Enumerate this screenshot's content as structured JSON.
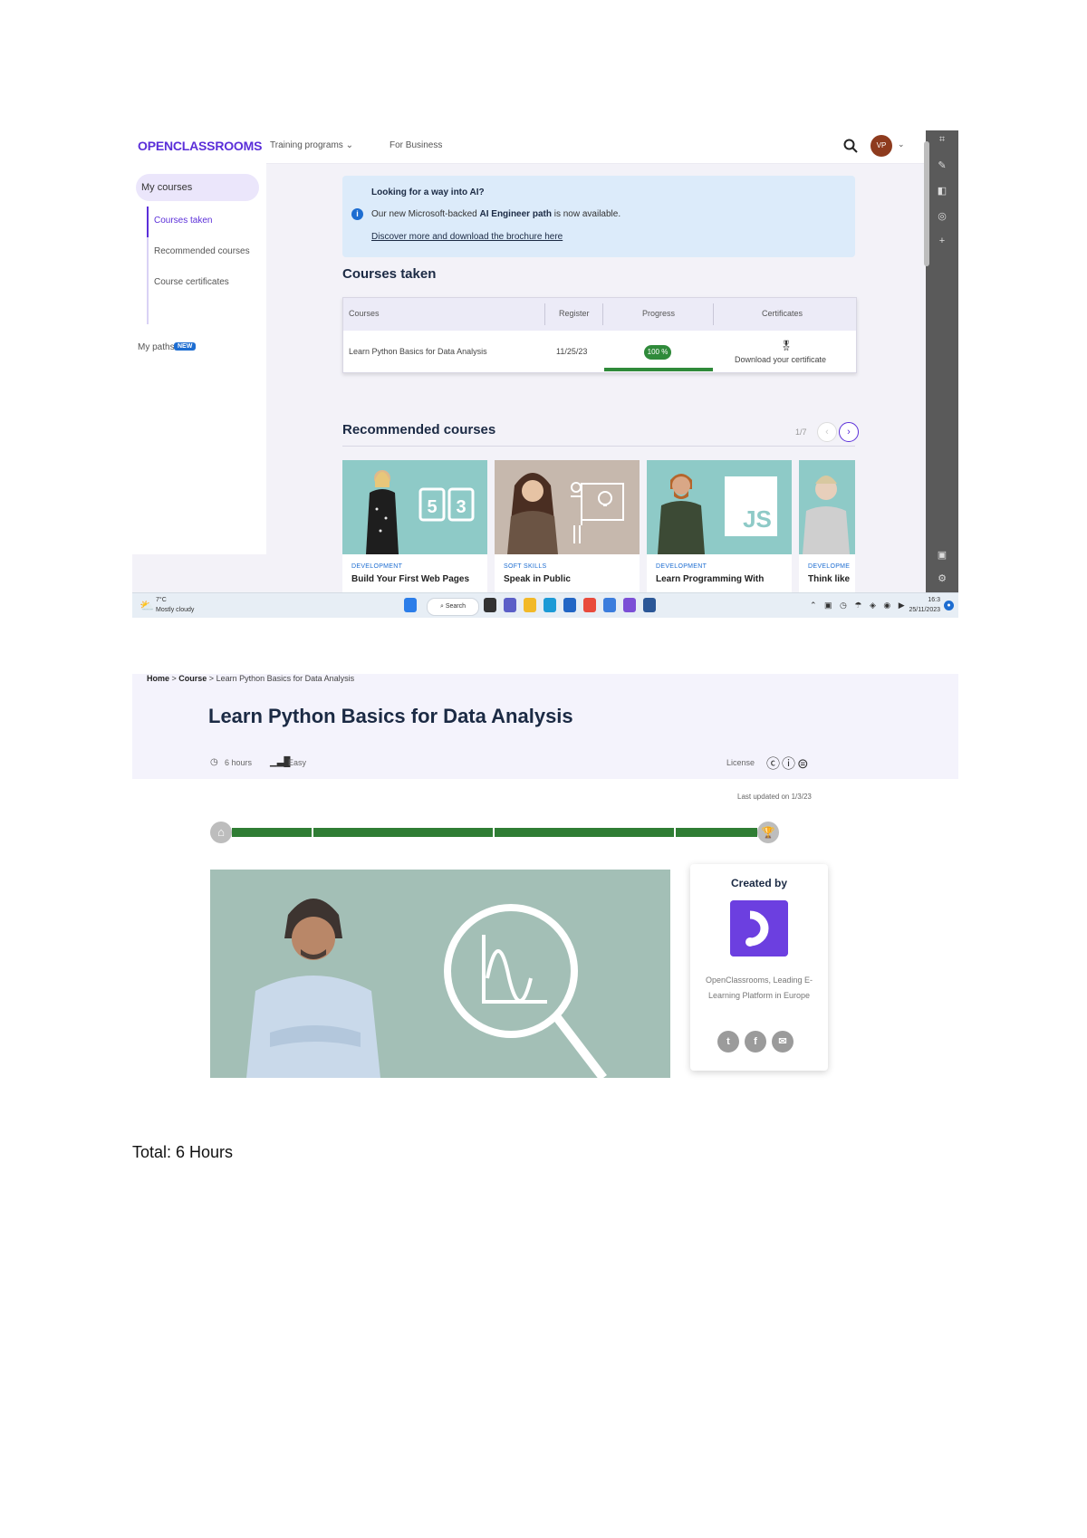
{
  "top_nav": {
    "logo": "OPENCLASSROOMS",
    "training": "Training programs",
    "business": "For Business",
    "avatar_initials": "VP"
  },
  "sidebar": {
    "my_courses": "My courses",
    "items": [
      "Courses taken",
      "Recommended courses",
      "Course certificates"
    ],
    "my_paths": "My paths",
    "new_badge": "NEW"
  },
  "banner": {
    "title": "Looking for a way into AI?",
    "text_pre": "Our new Microsoft-backed ",
    "text_bold": "AI Engineer path",
    "text_post": " is now available.",
    "link": "Discover more and download the brochure here"
  },
  "courses_taken": {
    "title": "Courses taken",
    "headers": [
      "Courses",
      "Register",
      "Progress",
      "Certificates"
    ],
    "row": {
      "course": "Learn Python Basics for Data Analysis",
      "register": "11/25/23",
      "progress": "100 %",
      "progress_value": 1.0,
      "certificate": "Download your certificate"
    }
  },
  "recommended": {
    "title": "Recommended courses",
    "pages": "1/7",
    "cards": [
      {
        "category": "DEVELOPMENT",
        "title": "Build Your First Web Pages"
      },
      {
        "category": "SOFT SKILLS",
        "title": "Speak in Public"
      },
      {
        "category": "DEVELOPMENT",
        "title": "Learn Programming With"
      },
      {
        "category": "DEVELOPME",
        "title": "Think like"
      }
    ]
  },
  "taskbar": {
    "temp": "7°C",
    "weather": "Mostly cloudy",
    "search": "Search",
    "time": "16:3",
    "date": "25/11/2023"
  },
  "course_page": {
    "breadcrumb_home": "Home",
    "breadcrumb_course": "Course",
    "breadcrumb_current": "Learn Python Basics for Data Analysis",
    "title": "Learn Python Basics for Data Analysis",
    "hours": "6 hours",
    "level": "Easy",
    "license": "License",
    "last_updated": "Last updated on 1/3/23",
    "created_by": "Created by",
    "creator_desc": "OpenClassrooms, Leading E-Learning Platform in Europe"
  },
  "footer": {
    "total": "Total: 6 Hours"
  },
  "colors": {
    "brand": "#5b2fd9",
    "progress_green": "#2f7d34",
    "banner_bg": "#dcebfa",
    "hero_bg": "#f4f3fc"
  }
}
